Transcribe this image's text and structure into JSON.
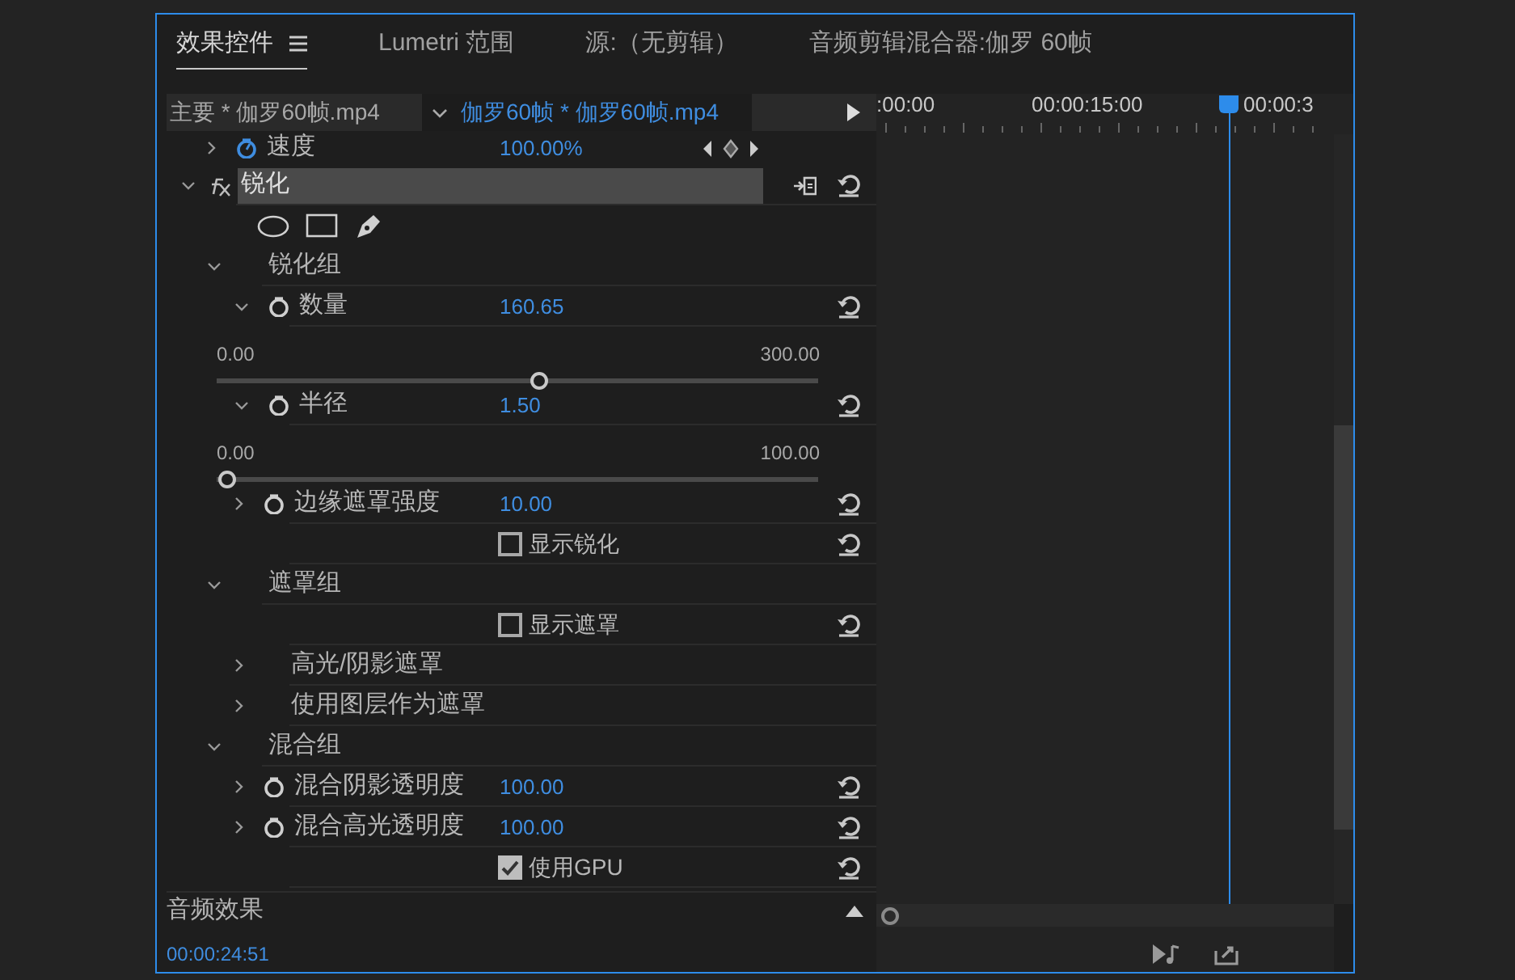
{
  "tabs": [
    {
      "label": "效果控件",
      "selected": true,
      "menu": true
    },
    {
      "label": "Lumetri 范围",
      "selected": false
    },
    {
      "label": "源:（无剪辑）",
      "selected": false
    },
    {
      "label": "音频剪辑混合器:伽罗 60帧",
      "selected": false
    }
  ],
  "clip_header": {
    "master": "主要 * 伽罗60帧.mp4",
    "sequence": "伽罗60帧 * 伽罗60帧.mp4"
  },
  "timeline": {
    "ruler_labels": [
      ":00:00",
      "00:00:15:00",
      "00:00:3"
    ]
  },
  "rows": [
    {
      "kind": "param",
      "name": "速度",
      "expanded": false,
      "animated": true,
      "value": "100.00%",
      "keyframe_nav": true
    },
    {
      "kind": "effect",
      "name": "锐化",
      "expanded": true,
      "children": [
        {
          "kind": "mask_tools"
        },
        {
          "kind": "group",
          "name": "锐化组",
          "expanded": true,
          "children": [
            {
              "kind": "param",
              "name": "数量",
              "expanded": true,
              "animated": false,
              "value": "160.65",
              "slider": {
                "min": "0.00",
                "max": "300.00",
                "level": 0.535
              }
            },
            {
              "kind": "param",
              "name": "半径",
              "expanded": true,
              "animated": false,
              "value": "1.50",
              "slider": {
                "min": "0.00",
                "max": "100.00",
                "level": 0.015
              }
            },
            {
              "kind": "param",
              "name": "边缘遮罩强度",
              "expanded": false,
              "animated": false,
              "value": "10.00"
            },
            {
              "kind": "checkbox",
              "label": "显示锐化",
              "checked": false
            }
          ]
        },
        {
          "kind": "group",
          "name": "遮罩组",
          "expanded": true,
          "children": [
            {
              "kind": "checkbox",
              "label": "显示遮罩",
              "checked": false
            },
            {
              "kind": "group",
              "name": "高光/阴影遮罩",
              "expanded": false
            },
            {
              "kind": "group",
              "name": "使用图层作为遮罩",
              "expanded": false
            }
          ]
        },
        {
          "kind": "group",
          "name": "混合组",
          "expanded": true,
          "children": [
            {
              "kind": "param",
              "name": "混合阴影透明度",
              "expanded": false,
              "animated": false,
              "value": "100.00"
            },
            {
              "kind": "param",
              "name": "混合高光透明度",
              "expanded": false,
              "animated": false,
              "value": "100.00"
            },
            {
              "kind": "checkbox",
              "label": "使用GPU",
              "checked": true
            }
          ]
        }
      ]
    }
  ],
  "audio_section": {
    "label": "音频效果",
    "expanded": false
  },
  "status": {
    "time": "00:00:24:51"
  }
}
